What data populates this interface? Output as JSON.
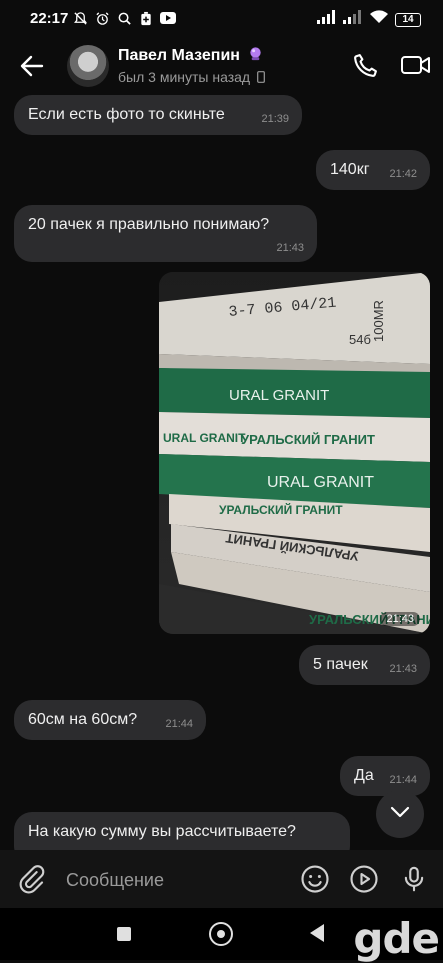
{
  "status_bar": {
    "time": "22:17",
    "battery": "14",
    "icons": [
      "mute-bell-icon",
      "alarm-icon",
      "search-icon",
      "battery-saver-icon",
      "youtube-icon",
      "signal-icon",
      "wifi-icon"
    ]
  },
  "header": {
    "title": "Павел Мазепин",
    "status": "был 3 минуты назад"
  },
  "messages": [
    {
      "text": "Если есть фото то скиньте",
      "time": "21:39",
      "side": "in"
    },
    {
      "text": "140кг",
      "time": "21:42",
      "side": "out"
    },
    {
      "text": "20 пачек я правильно понимаю?",
      "time": "21:43",
      "side": "in"
    },
    {
      "type": "photo",
      "time": "21:43",
      "side": "out",
      "photo_text": [
        "URAL GRANIT",
        "УРАЛЬСКИЙ ГРАНИТ",
        "3-7 06 04/21",
        "54б",
        "100МR"
      ]
    },
    {
      "text": "5 пачек",
      "time": "21:43",
      "side": "out"
    },
    {
      "text": "60см на 60см?",
      "time": "21:44",
      "side": "in"
    },
    {
      "text": "Да",
      "time": "21:44",
      "side": "out"
    },
    {
      "text": "На какую сумму вы рассчитываете?",
      "time": "",
      "side": "in"
    }
  ],
  "composer": {
    "placeholder": "Сообщение"
  },
  "watermark": "gde",
  "colors": {
    "background": "#0c0c0c",
    "bubble": "#2c2c2e",
    "photo_green": "#1f6b47"
  }
}
